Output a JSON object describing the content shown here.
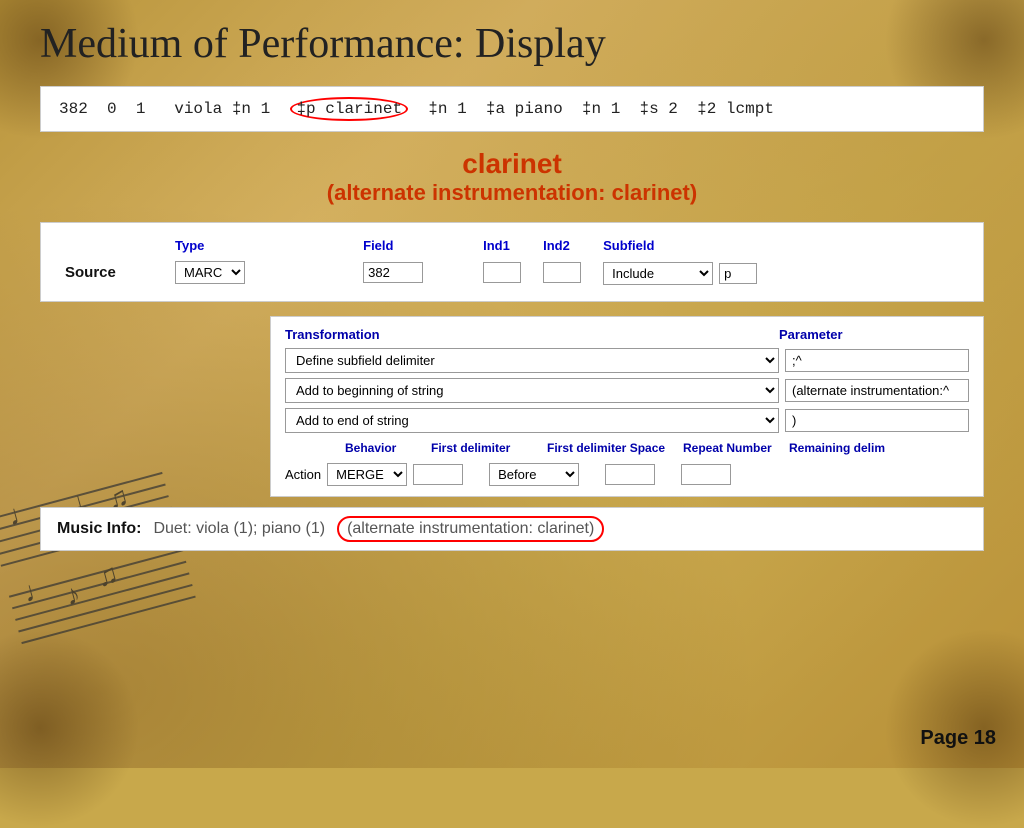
{
  "title": "Medium of Performance: Display",
  "marc_record": {
    "text": "382  0  1   viola ‡n 1  ‡p clarinet  ‡n 1  ‡a piano  ‡n 1  ‡s 2  ‡2 lcmpt",
    "circled_word": "clarinet"
  },
  "clarinet_display": {
    "main": "clarinet",
    "sub": "(alternate instrumentation: clarinet)"
  },
  "source_table": {
    "headers": {
      "type": "Type",
      "field": "Field",
      "ind1": "Ind1",
      "ind2": "Ind2",
      "subfield": "Subfield"
    },
    "row": {
      "label": "Source",
      "type_value": "MARC",
      "field_value": "382",
      "ind1_value": "",
      "ind2_value": "",
      "subfield_select": "Include",
      "subfield_value": "p"
    }
  },
  "transformation_panel": {
    "col_transform": "Transformation",
    "col_param": "Parameter",
    "rows": [
      {
        "transform": "Define subfield delimiter",
        "param": ";^"
      },
      {
        "transform": "Add to beginning of string",
        "param": "(alternate instrumentation:^"
      },
      {
        "transform": "Add to end of string",
        "param": ")"
      }
    ],
    "behavior_headers": {
      "behavior": "Behavior",
      "first_delimiter": "First delimiter",
      "first_delimiter_space": "First delimiter Space",
      "repeat_number": "Repeat Number",
      "remaining_delim": "Remaining delim"
    },
    "action_row": {
      "label": "Action",
      "merge": "MERGE",
      "first_delim_value": "",
      "space_select": "Before",
      "repeat_value": "",
      "remaining_value": ""
    }
  },
  "bottom_bar": {
    "label": "Music Info:",
    "text_before": "Duet: viola (1); piano (1)",
    "circled_text": "(alternate instrumentation: clarinet)"
  },
  "page_number": "Page 18"
}
